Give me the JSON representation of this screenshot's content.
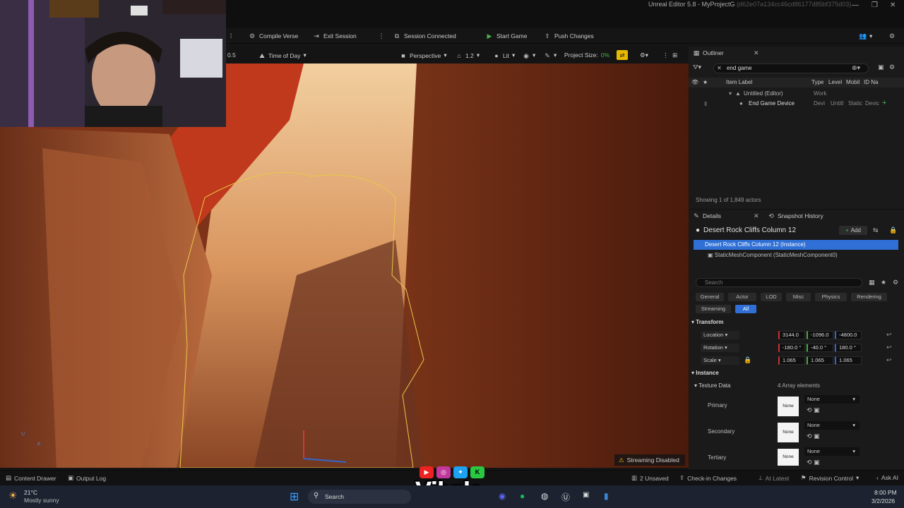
{
  "window": {
    "title": "Unreal Editor 5.8 - MyProjectG",
    "hash": "(d62e07a134cc46cd86177d85bf375d03)"
  },
  "toolbar": {
    "compile_verse": "Compile Verse",
    "exit_session": "Exit Session",
    "session_connected": "Session Connected",
    "start_game": "Start Game",
    "push_changes": "Push Changes"
  },
  "viewport_bar": {
    "speed": "0.5",
    "time_of_day": "Time of Day",
    "perspective": "Perspective",
    "fov": "1.2",
    "lit": "Lit",
    "project_size_label": "Project Size:",
    "project_size_value": "0%"
  },
  "viewport": {
    "streaming": "Streaming Disabled",
    "axis_u": "U",
    "axis_f": "F"
  },
  "outliner": {
    "tab": "Outliner",
    "search_value": "end game",
    "columns": [
      "Item Label",
      "Type",
      "Level",
      "Mobil",
      "ID Na"
    ],
    "rows": [
      {
        "label": "Untitled (Editor)",
        "type": "Work",
        "level": "",
        "mobil": ""
      },
      {
        "label": "End Game Device",
        "type": "Devi",
        "level": "Untitl",
        "mobil": "Static",
        "id": "Devic"
      }
    ],
    "footer": "Showing 1 of 1,849 actors"
  },
  "details": {
    "tab": "Details",
    "tab2": "Snapshot History",
    "actor_name": "Desert Rock Cliffs Column 12",
    "add": "Add",
    "instance": "Desert Rock Cliffs Column 12 (Instance)",
    "component": "StaticMeshComponent (StaticMeshComponent0)",
    "search_placeholder": "Search",
    "categories": [
      "General",
      "Actor",
      "LOD",
      "Misc",
      "Physics",
      "Rendering",
      "Streaming",
      "All"
    ],
    "transform_label": "Transform",
    "location": {
      "label": "Location",
      "x": "3144.0",
      "y": "-1096.0",
      "z": "-4800.0"
    },
    "rotation": {
      "label": "Rotation",
      "x": "-180.0 °",
      "y": "-40.0 °",
      "z": "180.0 °"
    },
    "scale": {
      "label": "Scale",
      "x": "1.065",
      "y": "1.065",
      "z": "1.065"
    },
    "instance_label": "Instance",
    "texture_data": "Texture Data",
    "array_elements": "4 Array elements",
    "textures": [
      {
        "label": "Primary",
        "value": "None",
        "swatch": "None"
      },
      {
        "label": "Secondary",
        "value": "None",
        "swatch": "None"
      },
      {
        "label": "Tertiary",
        "value": "None",
        "swatch": "None"
      }
    ]
  },
  "statusbar": {
    "content_drawer": "Content Drawer",
    "output_log": "Output Log",
    "unsaved": "2 Unsaved",
    "check_in": "Check-in Changes",
    "at_latest": "At Latest",
    "revision_control": "Revision Control",
    "ask_ai": "Ask AI"
  },
  "overlay": {
    "brand": "Vibzlo"
  },
  "taskbar": {
    "temp": "21°C",
    "weather": "Mostly sunny",
    "search": "Search",
    "time": "8:00 PM",
    "date": "3/2/2026"
  },
  "colors": {
    "accent_blue": "#2f6fd6",
    "yellow": "#e8b800",
    "green": "#4caf50"
  }
}
